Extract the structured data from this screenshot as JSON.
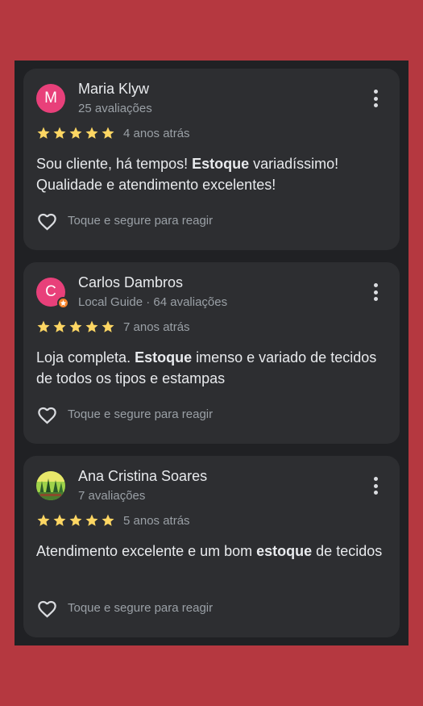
{
  "reviews": [
    {
      "avatar_letter": "M",
      "name": "Maria Klyw",
      "meta": "25 avaliações",
      "rating": 5,
      "ago": "4 anos atrás",
      "text_before": "Sou cliente, há tempos! ",
      "text_bold": "Estoque",
      "text_after": " variadíssimo! Qualidade e atendimento excelentes!",
      "react_label": "Toque e segure para reagir"
    },
    {
      "avatar_letter": "C",
      "name": "Carlos Dambros",
      "meta": "Local Guide · 64 avaliações",
      "rating": 5,
      "ago": "7 anos atrás",
      "text_before": "Loja completa. ",
      "text_bold": "Estoque",
      "text_after": " imenso e variado de tecidos de todos os tipos e estampas",
      "react_label": "Toque e segure para reagir"
    },
    {
      "avatar_letter": "",
      "name": "Ana Cristina Soares",
      "meta": "7 avaliações",
      "rating": 5,
      "ago": "5 anos atrás",
      "text_before": "Atendimento excelente e um bom ",
      "text_bold": "estoque",
      "text_after": " de tecidos",
      "react_label": "Toque e segure para reagir"
    }
  ],
  "colors": {
    "background": "#b53840",
    "panel": "#202124",
    "card": "#2d2e31",
    "star": "#fdd663",
    "avatar_pink": "#e8407a",
    "guide_badge": "#f5832a"
  },
  "icons": {
    "menu": "more-vert-icon",
    "react": "heart-outline-icon",
    "star": "star-icon",
    "guide": "local-guide-badge-icon"
  }
}
